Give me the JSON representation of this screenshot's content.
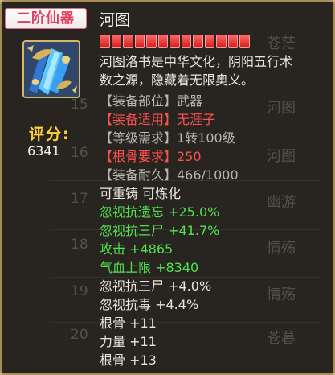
{
  "item": {
    "grade": "二阶仙器",
    "name": "河图",
    "stars": 13,
    "desc_line1": "河图洛书是中华文化，阴阳五行术",
    "desc_line2": "数之源，隐藏着无限奥义。",
    "score_label": "评分:",
    "score_value": "6341"
  },
  "attributes": [
    {
      "text": "【装备部位】武器",
      "color": "gray"
    },
    {
      "text": "【装备适用】无涯子",
      "color": "red"
    },
    {
      "text": "【等级需求】1转100级",
      "color": "gray"
    },
    {
      "text": "【根骨要求】250",
      "color": "red"
    },
    {
      "text": "【装备耐久】466/1000",
      "color": "gray"
    }
  ],
  "remake": "可重铸 可炼化",
  "green_stats": [
    "忽视抗遗忘 +25.0%",
    "忽视抗三尸 +41.7%"
  ],
  "base_stats": [
    "攻击 +4865",
    "气血上限 +8340",
    "忽视抗三尸 +4.0%",
    "忽视抗毒 +4.4%",
    "根骨 +11",
    "力量 +11",
    "根骨 +13"
  ],
  "background_list": {
    "numbers": [
      "15",
      "16",
      "17",
      "18",
      "19",
      "20"
    ],
    "names": [
      "苍茫",
      "河图",
      "河图",
      "幽游",
      "情殇",
      "情殇",
      "苍暮"
    ]
  },
  "colors": {
    "gray": "#b9b6ae",
    "red": "#ff5050",
    "green": "#4fe24f",
    "white": "#e8e6df",
    "gold": "#ffd23a"
  }
}
